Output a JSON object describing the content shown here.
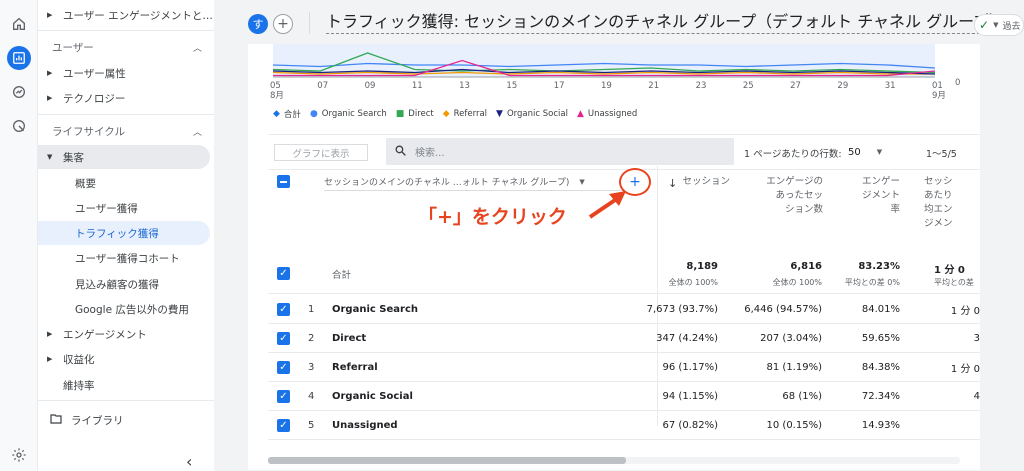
{
  "header": {
    "avatar_letter": "す",
    "add_label": "+",
    "title": "トラフィック獲得: セッションのメインのチャネル グループ（デフォルト チャネル グループ）",
    "status_text": "過去"
  },
  "sidebar": {
    "row_top": "ユーザー エンゲージメントと…",
    "section_user": "ユーザー",
    "item_user_attr": "ユーザー属性",
    "item_tech": "テクノロジー",
    "section_lifecycle": "ライフサイクル",
    "cat_acquisition": "集客",
    "sub_items": [
      "概要",
      "ユーザー獲得",
      "トラフィック獲得",
      "ユーザー獲得コホート",
      "見込み顧客の獲得",
      "Google 広告以外の費用"
    ],
    "item_engagement": "エンゲージメント",
    "item_monetization": "収益化",
    "item_retention": "維持率",
    "library": "ライブラリ",
    "collapse_icon": "‹"
  },
  "chart_data": {
    "type": "line",
    "x": [
      "05",
      "07",
      "09",
      "11",
      "13",
      "15",
      "17",
      "19",
      "21",
      "23",
      "25",
      "27",
      "29",
      "31",
      "01"
    ],
    "x_sub": {
      "05": "8月",
      "01": "9月"
    },
    "y_tick": "0",
    "legend": [
      {
        "name": "合計",
        "color": "#1a73e8",
        "marker": "pin"
      },
      {
        "name": "Organic Search",
        "color": "#4285f4",
        "marker": "circle"
      },
      {
        "name": "Direct",
        "color": "#34a853",
        "marker": "square"
      },
      {
        "name": "Referral",
        "color": "#f29900",
        "marker": "diamond"
      },
      {
        "name": "Organic Social",
        "color": "#1a237e",
        "marker": "triangle-down"
      },
      {
        "name": "Unassigned",
        "color": "#e52592",
        "marker": "triangle-up"
      }
    ],
    "series": [
      {
        "name": "Organic Search",
        "color": "#4285f4",
        "values": [
          8,
          7,
          9,
          8,
          8,
          7,
          8,
          9,
          8,
          8,
          7,
          8,
          9,
          8,
          6
        ]
      },
      {
        "name": "Direct",
        "color": "#34a853",
        "values": [
          5,
          4,
          16,
          5,
          4,
          5,
          4,
          5,
          6,
          4,
          5,
          4,
          5,
          4,
          3
        ]
      },
      {
        "name": "Referral",
        "color": "#f29900",
        "values": [
          3,
          2,
          3,
          2,
          3,
          2,
          3,
          2,
          3,
          2,
          3,
          2,
          3,
          2,
          2
        ]
      },
      {
        "name": "Organic Social",
        "color": "#1a237e",
        "values": [
          4,
          3,
          4,
          3,
          5,
          3,
          4,
          3,
          4,
          3,
          4,
          3,
          4,
          3,
          2
        ]
      },
      {
        "name": "Unassigned",
        "color": "#e52592",
        "values": [
          1,
          1,
          1,
          1,
          11,
          1,
          1,
          1,
          1,
          1,
          1,
          1,
          1,
          1,
          4
        ]
      }
    ]
  },
  "toolbar": {
    "chart_btn": "グラフに表示",
    "search_placeholder": "検索...",
    "rows_label": "1 ページあたりの行数:",
    "rows_value": "50",
    "pager": "1〜5/5"
  },
  "table": {
    "dimension_label": "セッションのメインのチャネル …ォルト チャネル グループ)",
    "add_dim": "+",
    "col_sessions": "セッション",
    "col_engaged": [
      "エンゲージの",
      "あったセッ",
      "ション数"
    ],
    "col_rate": [
      "エンゲー",
      "ジメント",
      "率"
    ],
    "col_avg": [
      "セッシ",
      "あたり",
      "均エン",
      "ジメン"
    ],
    "total_label": "合計",
    "totals": {
      "sessions": "8,189",
      "sessions_sub": "全体の 100%",
      "engaged": "6,816",
      "engaged_sub": "全体の 100%",
      "rate": "83.23%",
      "rate_sub": "平均との差 0%",
      "avg": "1 分 0",
      "avg_sub": "平均との差"
    },
    "rows": [
      {
        "idx": "1",
        "name": "Organic Search",
        "sessions": "7,673 (93.7%)",
        "engaged": "6,446 (94.57%)",
        "rate": "84.01%",
        "avg": "1 分 0"
      },
      {
        "idx": "2",
        "name": "Direct",
        "sessions": "347 (4.24%)",
        "engaged": "207 (3.04%)",
        "rate": "59.65%",
        "avg": "3"
      },
      {
        "idx": "3",
        "name": "Referral",
        "sessions": "96 (1.17%)",
        "engaged": "81 (1.19%)",
        "rate": "84.38%",
        "avg": "1 分 0"
      },
      {
        "idx": "4",
        "name": "Organic Social",
        "sessions": "94 (1.15%)",
        "engaged": "68 (1%)",
        "rate": "72.34%",
        "avg": "4"
      },
      {
        "idx": "5",
        "name": "Unassigned",
        "sessions": "67 (0.82%)",
        "engaged": "10 (0.15%)",
        "rate": "14.93%",
        "avg": ""
      }
    ]
  },
  "annotation": {
    "text": "「+」をクリック",
    "color": "#e8431f"
  }
}
